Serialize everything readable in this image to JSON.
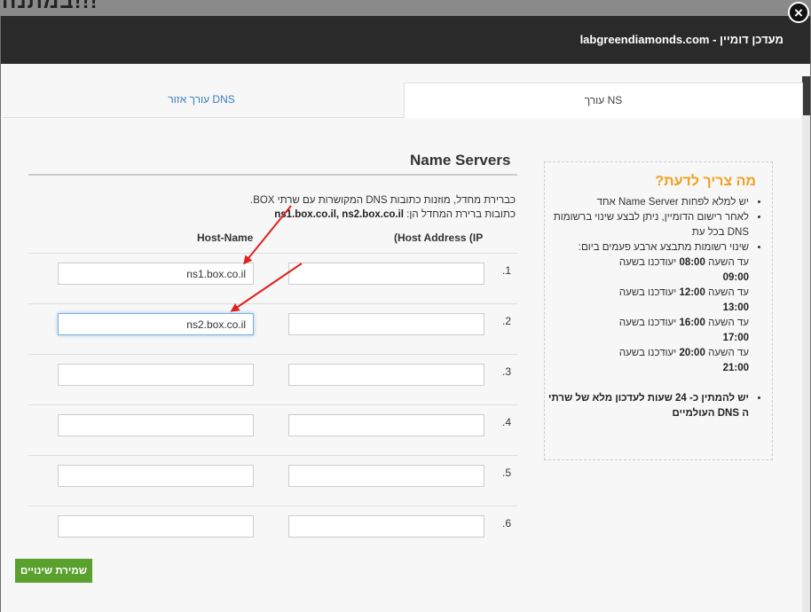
{
  "background": {
    "title_fragment": "במתנה!!!"
  },
  "modal": {
    "title": "מעדכן דומיין - labgreendiamonds.com",
    "close_glyph": "×"
  },
  "tabs": [
    {
      "label": "עורך NS",
      "active": true
    },
    {
      "label": "עורך אזור DNS",
      "active": false
    }
  ],
  "name_servers": {
    "title": "Name Servers",
    "desc_line1": "כברירת מחדל, מוזנות כתובות DNS המקושרות עם שרתי BOX.",
    "desc_line2_prefix": "כתובות ברירת המחדל הן:",
    "desc_line2_bold": "ns1.box.co.il, ns2.box.co.il",
    "col_ip": "(Host Address (IP",
    "col_host": "Host-Name",
    "rows": [
      {
        "num": ".1",
        "ip": "",
        "host": "ns1.box.co.il"
      },
      {
        "num": ".2",
        "ip": "",
        "host": "ns2.box.co.il"
      },
      {
        "num": ".3",
        "ip": "",
        "host": ""
      },
      {
        "num": ".4",
        "ip": "",
        "host": ""
      },
      {
        "num": ".5",
        "ip": "",
        "host": ""
      },
      {
        "num": ".6",
        "ip": "",
        "host": ""
      }
    ]
  },
  "info": {
    "title": "מה צריך לדעת?",
    "item1": "יש למלא לפחות Name Server אחד",
    "item2": "לאחר רישום הדומיין, ניתן לבצע שינוי ברשומות DNS בכל עת",
    "item3": "שינוי רשומות מתבצע ארבע פעמים ביום:",
    "schedule": [
      {
        "prefix": "עד השעה",
        "from": "08:00",
        "mid": "יעודכנו בשעה",
        "to": "09:00"
      },
      {
        "prefix": "עד השעה",
        "from": "12:00",
        "mid": "יעודכנו בשעה",
        "to": "13:00"
      },
      {
        "prefix": "עד השעה",
        "from": "16:00",
        "mid": "יעודכנו בשעה",
        "to": "17:00"
      },
      {
        "prefix": "עד השעה",
        "from": "20:00",
        "mid": "יעודכנו בשעה",
        "to": "21:00"
      }
    ],
    "item4": "יש להמתין כ- 24 שעות לעדכון מלא של שרתי ה DNS העולמיים"
  },
  "save_button": "שמירת שינויים",
  "colors": {
    "accent_orange": "#f0a020",
    "save_green": "#5aa02c",
    "link_blue": "#3a7bbf",
    "arrow_red": "#e02020"
  }
}
